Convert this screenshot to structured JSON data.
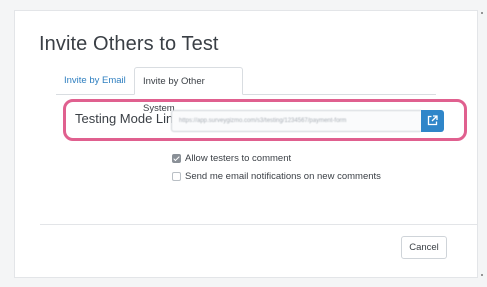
{
  "dialog": {
    "title": "Invite Others to Test"
  },
  "tabs": [
    {
      "label": "Invite by Email",
      "active": false
    },
    {
      "label": "Invite by Other System",
      "active": true
    }
  ],
  "testing_link": {
    "label": "Testing Mode Link",
    "value": "https://app.surveygizmo.com/s3/testing/1234567/payment-form",
    "open_icon": "external-link-icon",
    "highlight_color": "#e0608f",
    "button_color": "#2f86c9"
  },
  "options": [
    {
      "label": "Allow testers to comment",
      "checked": true
    },
    {
      "label": "Send me email notifications on new comments",
      "checked": false
    }
  ],
  "footer": {
    "cancel_label": "Cancel"
  }
}
